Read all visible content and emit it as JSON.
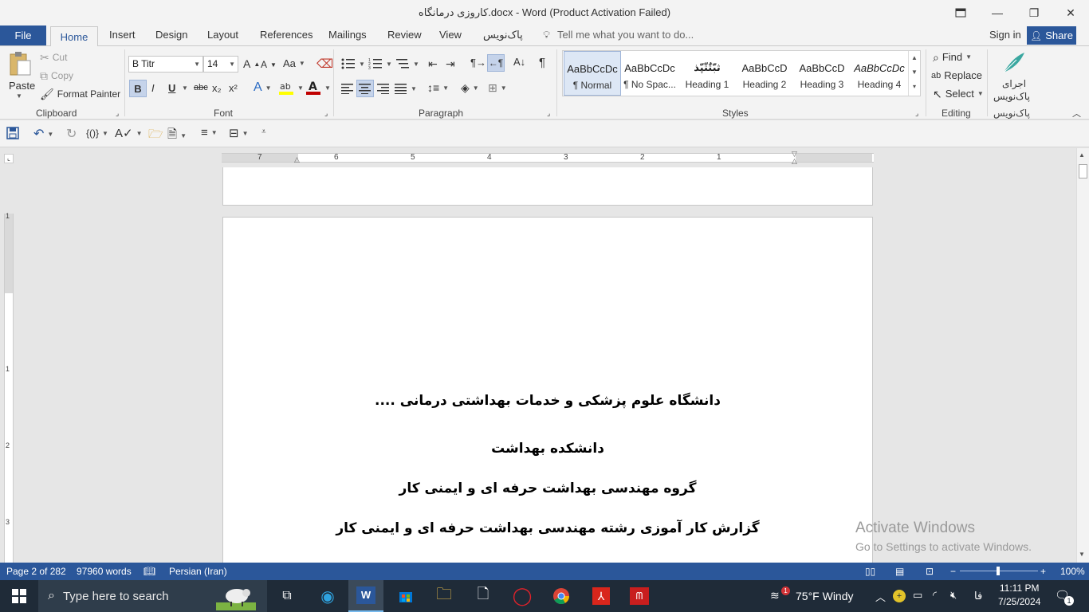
{
  "window": {
    "title": "کاروزی درمانگاه.docx - Word (Product Activation Failed)",
    "restore_icon": "ribbon-display-icon",
    "minimize_glyph": "—",
    "maximize_glyph": "❐",
    "close_glyph": "✕"
  },
  "tabs": {
    "file": "File",
    "items": [
      "Home",
      "Insert",
      "Design",
      "Layout",
      "References",
      "Mailings",
      "Review",
      "View",
      "پاک‌نویس"
    ],
    "tell_me": "Tell me what you want to do...",
    "sign_in": "Sign in",
    "share": "Share"
  },
  "clipboard": {
    "paste": "Paste",
    "cut": "Cut",
    "copy": "Copy",
    "format_painter": "Format Painter",
    "label": "Clipboard"
  },
  "font": {
    "name": "B Titr",
    "size": "14",
    "case_label": "Aa",
    "bold": "B",
    "italic": "I",
    "underline": "U",
    "strike": "abc",
    "sub": "x₂",
    "sup": "x²",
    "label": "Font"
  },
  "paragraph": {
    "label": "Paragraph",
    "pilcrow": "¶"
  },
  "styles": {
    "label": "Styles",
    "items": [
      {
        "sample": "AaBbCcDc",
        "name": "¶ Normal"
      },
      {
        "sample": "AaBbCcDc",
        "name": "¶ No Spac..."
      },
      {
        "sample": "ثبّتٌتّپّذ",
        "name": "Heading 1"
      },
      {
        "sample": "AaBbCcD",
        "name": "Heading 2"
      },
      {
        "sample": "AaBbCcD",
        "name": "Heading 3"
      },
      {
        "sample": "AaBbCcDc",
        "name": "Heading 4"
      }
    ]
  },
  "editing": {
    "find": "Find",
    "replace": "Replace",
    "select": "Select",
    "label": "Editing"
  },
  "paknevis": {
    "run": "اجرای",
    "run2": "پاک‌نویس",
    "label": "پاک‌نویس"
  },
  "ruler": {
    "h_numbers": [
      "7",
      "6",
      "5",
      "4",
      "3",
      "2",
      "1"
    ],
    "v_numbers": [
      "1",
      "1",
      "2",
      "3"
    ]
  },
  "document": {
    "lines": [
      "دانشگاه علوم پزشکی و خدمات بهداشتی درمانی ....",
      "دانشکده بهداشت",
      "گروه مهندسی بهداشت حرفه ای و ایمنی کار",
      "گزارش کار آموزی رشته مهندسی بهداشت حرفه ای و ایمنی کار"
    ]
  },
  "watermark": {
    "title": "Activate Windows",
    "subtitle": "Go to Settings to activate Windows."
  },
  "status": {
    "page": "Page 2 of 282",
    "words": "97960 words",
    "language": "Persian (Iran)",
    "zoom": "100%"
  },
  "taskbar": {
    "search_placeholder": "Type here to search",
    "weather": "75°F  Windy",
    "lang": "فا",
    "time": "11:11 PM",
    "date": "7/25/2024",
    "notif_count": "1",
    "weather_badge": "1"
  },
  "colors": {
    "word_blue": "#2b579a",
    "taskbar": "#1f2b38"
  }
}
